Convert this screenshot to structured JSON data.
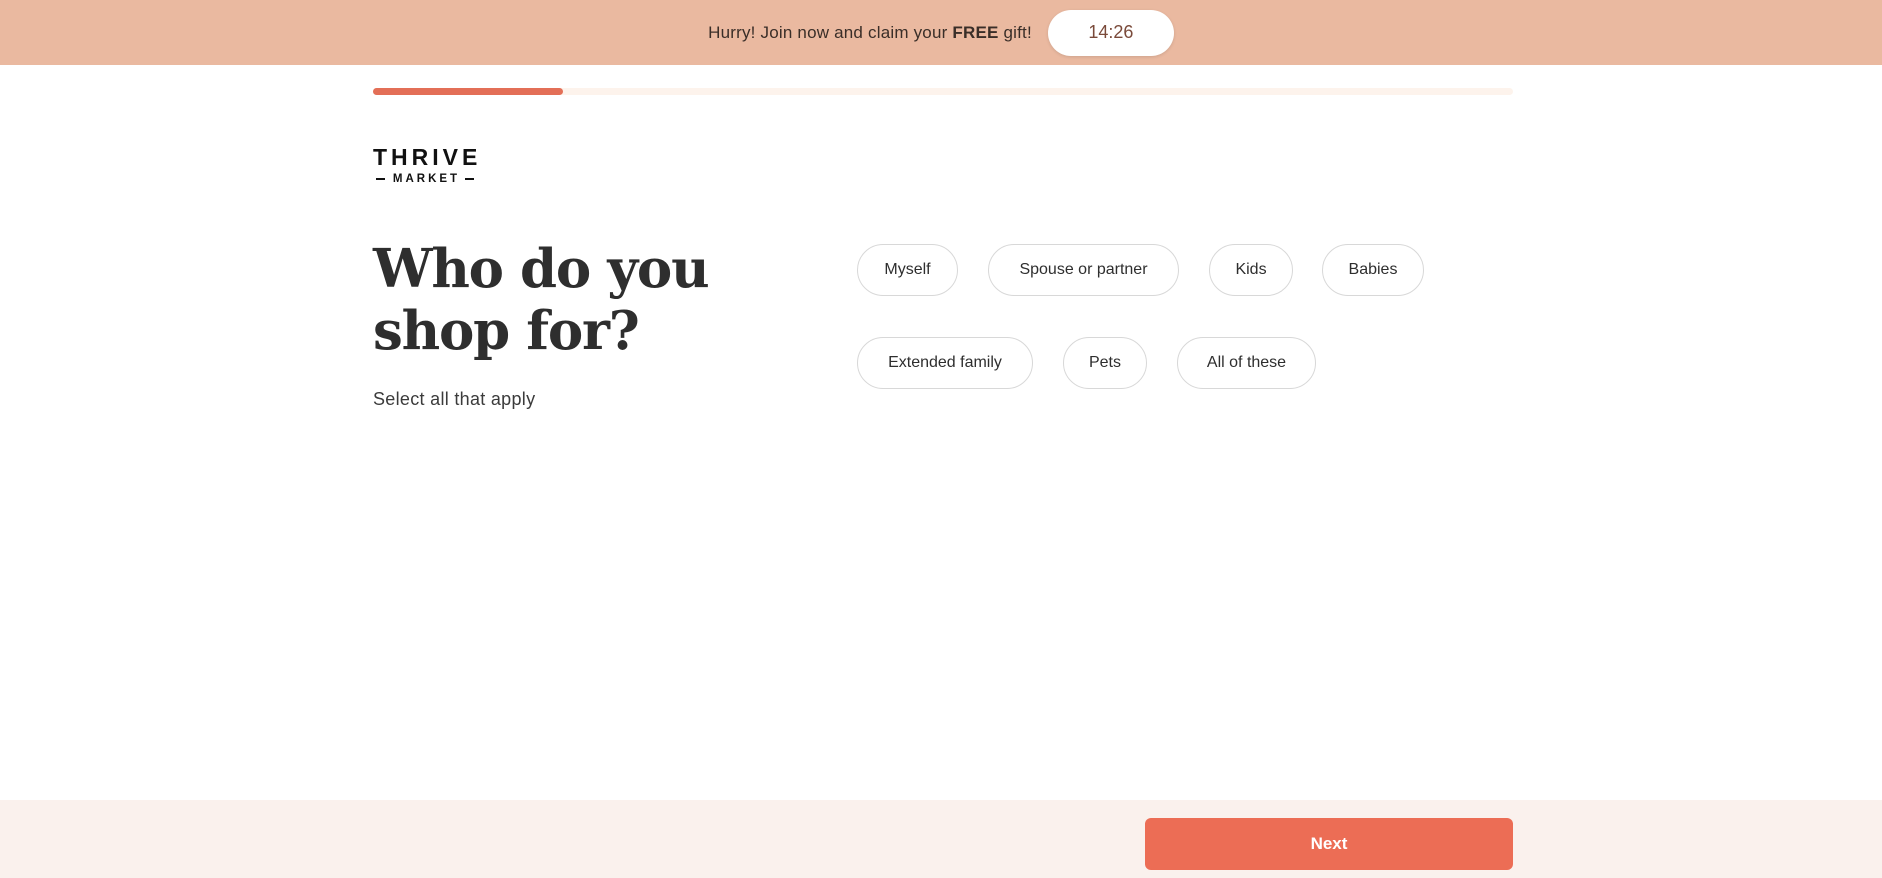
{
  "promo": {
    "text_before": "Hurry! Join now and claim your ",
    "text_bold": "FREE",
    "text_after": " gift!",
    "timer": "14:26",
    "background_color": "#eab9a0"
  },
  "progress": {
    "fraction": 0.167,
    "fill_color": "#e36f57"
  },
  "logo": {
    "top_text": "THRIVE",
    "bottom_text": "MARKET"
  },
  "question": {
    "title": "Who do you shop for?",
    "subtitle": "Select all that apply"
  },
  "options": [
    {
      "label": "Myself"
    },
    {
      "label": "Spouse or partner"
    },
    {
      "label": "Kids"
    },
    {
      "label": "Babies"
    },
    {
      "label": "Extended family"
    },
    {
      "label": "Pets"
    },
    {
      "label": "All of these"
    }
  ],
  "footer": {
    "next_label": "Next",
    "accent_color": "#ec6d55"
  }
}
